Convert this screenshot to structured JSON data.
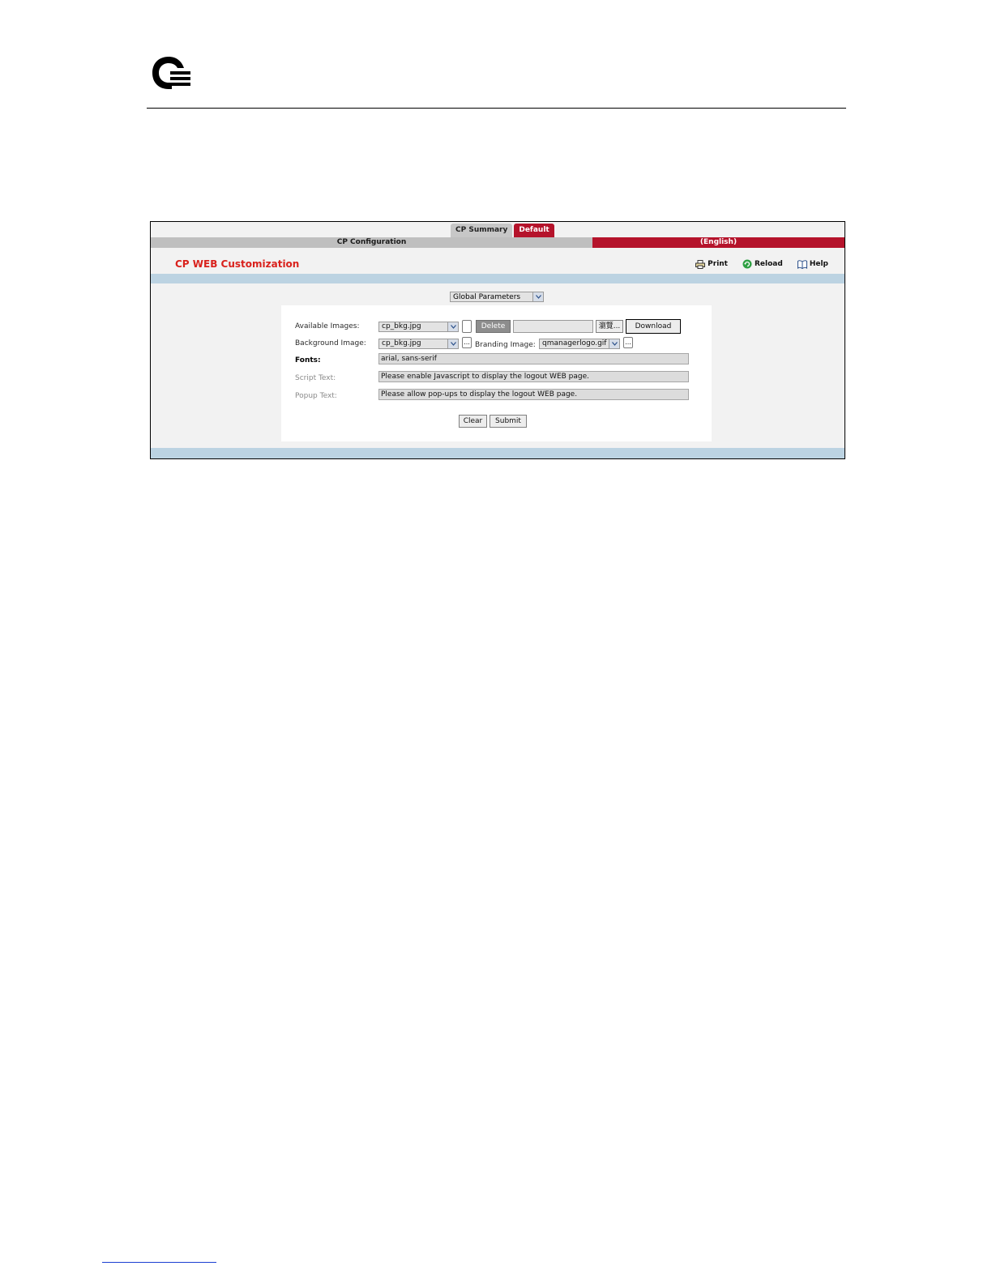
{
  "document": {
    "logo_icon": "quantum-q-icon"
  },
  "tabs": {
    "summary": "CP Summary",
    "default": "Default"
  },
  "subbar": {
    "left": "CP Configuration",
    "right": "(English)"
  },
  "page": {
    "title": "CP WEB Customization"
  },
  "toolbar": {
    "print": "Print",
    "reload": "Reload",
    "help": "Help"
  },
  "section_select": {
    "value": "Global Parameters"
  },
  "form": {
    "available_images_label": "Available Images:",
    "available_images_value": "cp_bkg.jpg",
    "delete_label": "Delete",
    "browse_label": "瀏覽...",
    "download_label": "Download",
    "background_image_label": "Background Image:",
    "background_image_value": "cp_bkg.jpg",
    "background_more": "...",
    "branding_image_label": "Branding Image:",
    "branding_image_value": "qmanagerlogo.gif",
    "branding_more": "...",
    "fonts_label": "Fonts:",
    "fonts_value": "arial, sans-serif",
    "script_text_label": "Script Text:",
    "script_text_value": "Please enable Javascript to display the logout WEB page.",
    "popup_text_label": "Popup Text:",
    "popup_text_value": "Please allow pop-ups to display the logout WEB page.",
    "clear_label": "Clear",
    "submit_label": "Submit"
  },
  "colors": {
    "accent_red": "#b5132b",
    "title_red": "#d9211c",
    "band_blue": "#bcd3e2"
  }
}
